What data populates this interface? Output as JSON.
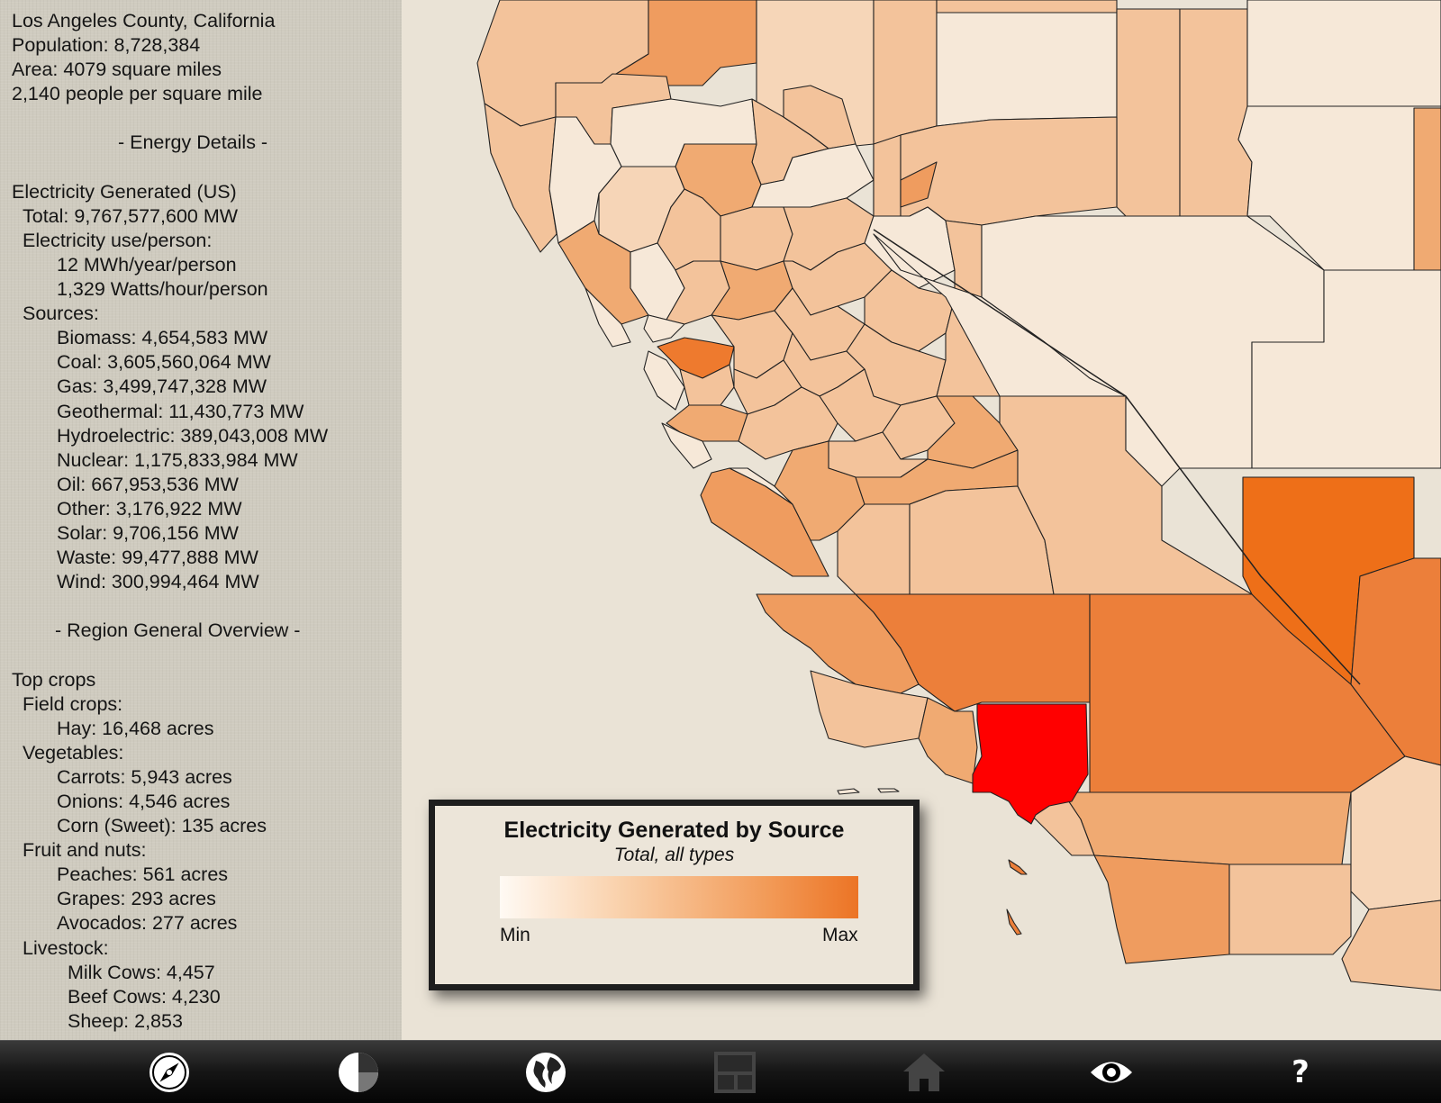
{
  "info": {
    "region": "Los Angeles County, California",
    "population": "Population: 8,728,384",
    "area": "Area: 4079 square miles",
    "density": "2,140 people per square mile",
    "energy_header": "- Energy Details -",
    "elec_header": "Electricity Generated (US)",
    "total": "Total: 9,767,577,600 MW",
    "use_header": "Electricity use/person:",
    "use_year": "12 MWh/year/person",
    "use_hour": "1,329 Watts/hour/person",
    "sources_header": "Sources:",
    "sources": [
      "Biomass: 4,654,583 MW",
      "Coal: 3,605,560,064 MW",
      "Gas: 3,499,747,328 MW",
      "Geothermal: 11,430,773 MW",
      "Hydroelectric: 389,043,008 MW",
      "Nuclear: 1,175,833,984 MW",
      "Oil: 667,953,536 MW",
      "Other: 3,176,922 MW",
      "Solar: 9,706,156 MW",
      "Waste: 99,477,888 MW",
      "Wind: 300,994,464 MW"
    ],
    "overview_header": "- Region General Overview -",
    "crops_header": "Top crops",
    "field_header": "Field crops:",
    "field": [
      "Hay: 16,468 acres"
    ],
    "veg_header": "Vegetables:",
    "veg": [
      "Carrots: 5,943 acres",
      "Onions: 4,546 acres",
      "Corn (Sweet): 135 acres"
    ],
    "fruit_header": "Fruit and nuts:",
    "fruit": [
      "Peaches: 561 acres",
      "Grapes: 293 acres",
      "Avocados: 277 acres"
    ],
    "livestock_header": "Livestock:",
    "livestock": [
      "Milk Cows: 4,457",
      "Beef Cows: 4,230",
      "Sheep: 2,853"
    ]
  },
  "legend": {
    "title": "Electricity Generated by Source",
    "subtitle": "Total, all types",
    "min_label": "Min",
    "max_label": "Max"
  },
  "map": {
    "selected_county_color": "#ff0000",
    "scale_colors": [
      "#f5e6d6",
      "#f6d5b7",
      "#f3c39b",
      "#f0aa72",
      "#ec7f3a",
      "#ee6f18"
    ]
  },
  "toolbar": {
    "buttons": [
      "compass-icon",
      "pie-chart-icon",
      "globe-icon",
      "layout-icon",
      "home-icon",
      "eye-icon",
      "help-icon"
    ],
    "help_label": "?"
  }
}
